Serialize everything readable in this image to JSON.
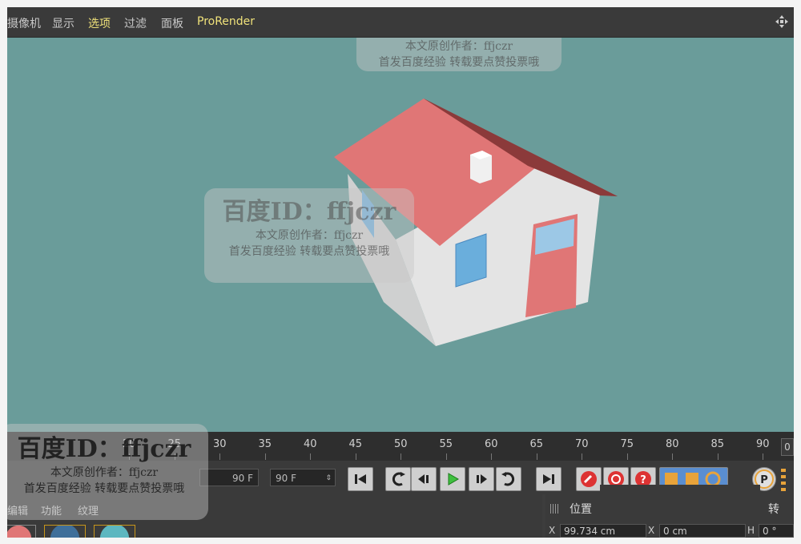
{
  "menu": {
    "items": [
      {
        "label": "摄像机"
      },
      {
        "label": "显示"
      },
      {
        "label": "选项"
      },
      {
        "label": "过滤"
      },
      {
        "label": "面板"
      },
      {
        "label": "ProRender"
      }
    ]
  },
  "watermark": {
    "id_text": "百度ID：ffjczr",
    "author": "本文原创作者：ffjczr",
    "notice": "首发百度经验  转载要点赞投票哦"
  },
  "timeline": {
    "ticks": [
      "20",
      "25",
      "30",
      "35",
      "40",
      "45",
      "50",
      "55",
      "60",
      "65",
      "70",
      "75",
      "80",
      "85",
      "90"
    ],
    "end_frame": "0"
  },
  "transport": {
    "range_end": "90 F",
    "max_frame": "90 F"
  },
  "bottom_tabs": [
    "编辑",
    "功能",
    "纹理"
  ],
  "attributes": {
    "position_header": "位置",
    "rotation_header": "转",
    "x_label": "X",
    "x_value": "99.734 cm",
    "x2_label": "X",
    "x2_value": "0 cm",
    "h_label": "H",
    "h_value": "0 °"
  },
  "colors": {
    "viewport_bg": "#6a9c9a",
    "roof": "#e07575",
    "wall": "#e3e3e3",
    "window": "#6aaedc",
    "door": "#e07575"
  }
}
